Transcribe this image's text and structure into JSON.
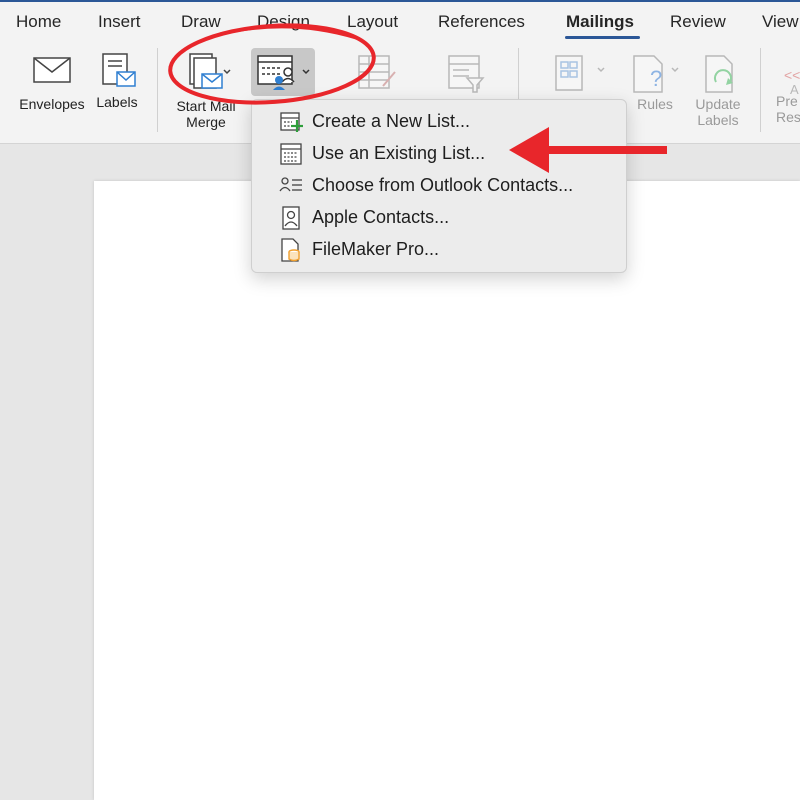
{
  "tabs": [
    "Home",
    "Insert",
    "Draw",
    "Design",
    "Layout",
    "References",
    "Mailings",
    "Review",
    "View"
  ],
  "active_tab": "Mailings",
  "ribbon": {
    "envelopes": "Envelopes",
    "labels": "Labels",
    "start_mail_merge_1": "Start Mail",
    "start_mail_merge_2": "Merge",
    "rules": "Rules",
    "update_labels_1": "Update",
    "update_labels_2": "Labels",
    "preview_1": "Pre",
    "preview_2": "Res"
  },
  "menu": {
    "items": [
      "Create a New List...",
      "Use an Existing List...",
      "Choose from Outlook Contacts...",
      "Apple Contacts...",
      "FileMaker Pro..."
    ]
  },
  "colors": {
    "accent": "#2b5797",
    "annotation_red": "#e8262b",
    "add_green": "#2e9e3b",
    "envelope_blue": "#2f7fd1",
    "filemaker_orange": "#f0a030"
  }
}
